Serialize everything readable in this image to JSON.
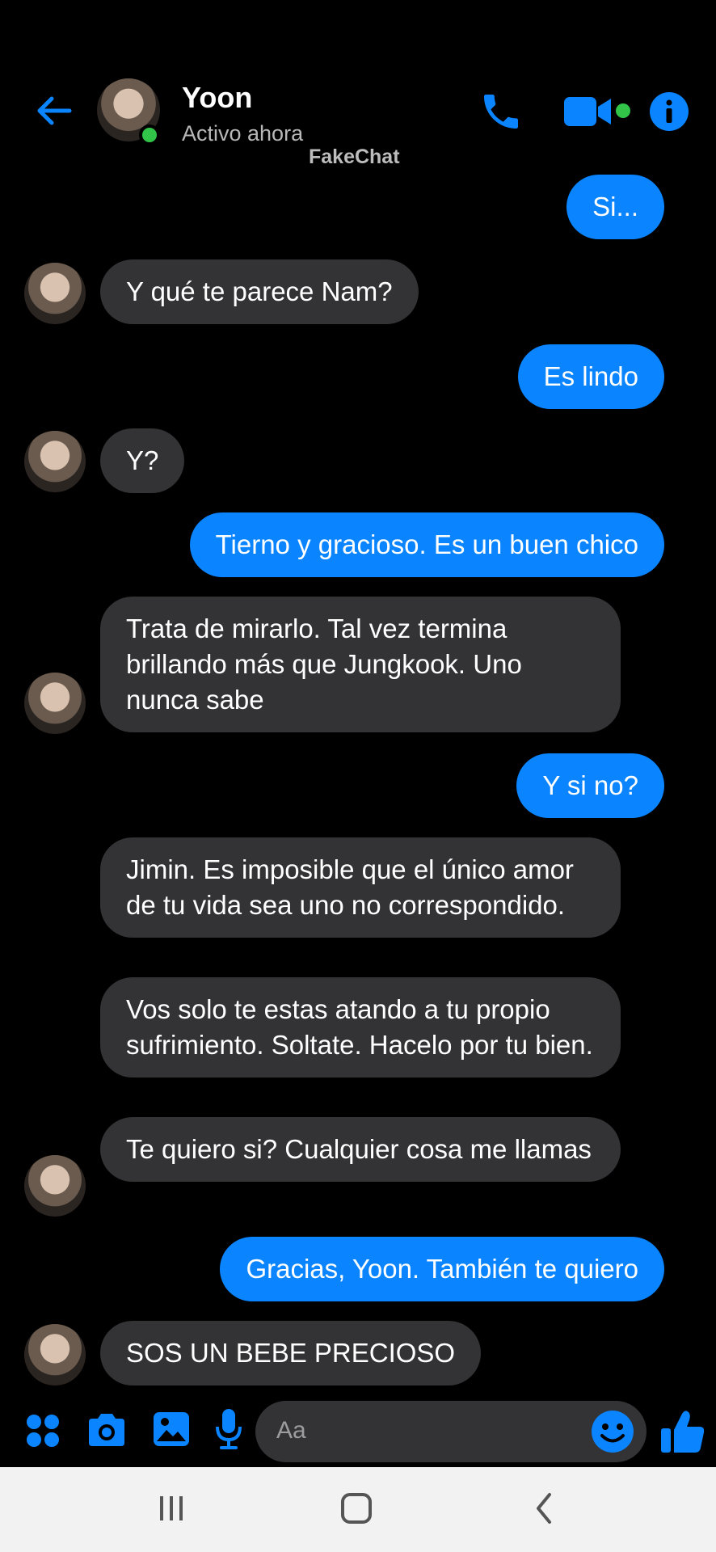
{
  "header": {
    "contact_name": "Yoon",
    "status": "Activo ahora",
    "watermark": "FakeChat",
    "accent": "#0a84ff",
    "online_color": "#31c449"
  },
  "messages": [
    {
      "from": "me",
      "text": "Si..."
    },
    {
      "from": "them",
      "text": "Y qué te parece Nam?"
    },
    {
      "from": "me",
      "text": "Es lindo"
    },
    {
      "from": "them",
      "text": "Y?"
    },
    {
      "from": "me",
      "text": "Tierno y gracioso. Es un buen chico"
    },
    {
      "from": "them",
      "text": "Trata de mirarlo. Tal vez termina brillando más que Jungkook. Uno nunca sabe"
    },
    {
      "from": "me",
      "text": "Y si no?"
    },
    {
      "from": "them",
      "text": "Jimin. Es imposible que el único amor de tu vida sea uno no correspondido."
    },
    {
      "from": "them",
      "text": "Vos solo te estas atando a tu propio sufrimiento. Soltate. Hacelo por tu bien."
    },
    {
      "from": "them",
      "text": "Te quiero si? Cualquier cosa me llamas"
    },
    {
      "from": "me",
      "text": "Gracias, Yoon. También te quiero"
    },
    {
      "from": "them",
      "text": "SOS UN BEBE PRECIOSO"
    }
  ],
  "composer": {
    "placeholder": "Aa",
    "icons": [
      "apps-icon",
      "camera-icon",
      "gallery-icon",
      "microphone-icon",
      "emoji-icon",
      "like-icon"
    ]
  },
  "navbar": {
    "icons": [
      "recent-apps-icon",
      "home-icon",
      "back-icon"
    ]
  }
}
